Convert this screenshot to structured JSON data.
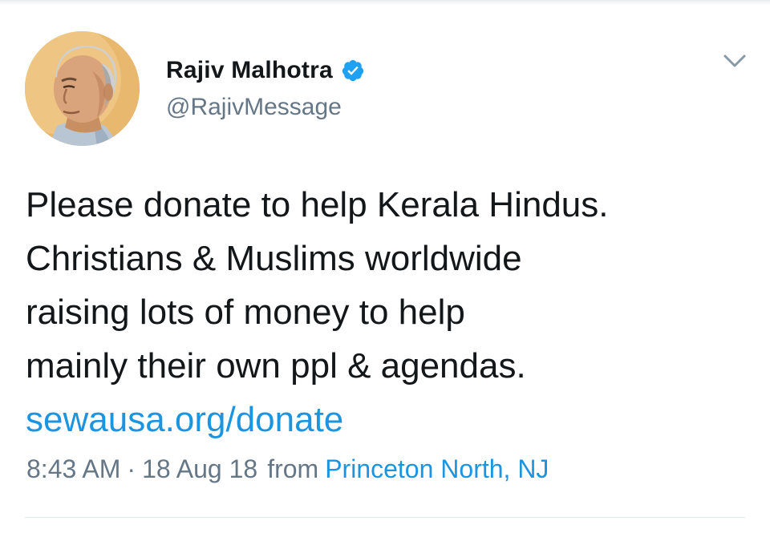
{
  "tweet": {
    "author": {
      "display_name": "Rajiv Malhotra",
      "handle": "@RajivMessage",
      "verified": true,
      "avatar_icon": "profile-photo"
    },
    "text_lines": [
      "Please donate to help Kerala Hindus.",
      "Christians & Muslims worldwide",
      "raising lots of money to help",
      "mainly their own ppl & agendas."
    ],
    "link": "sewausa.org/donate",
    "meta": {
      "time": "8:43 AM",
      "separator": "·",
      "date": "18 Aug 18",
      "from_label": "from",
      "location": "Princeton North, NJ"
    },
    "menu_icon": "chevron-down-icon"
  },
  "colors": {
    "text_primary": "#14171a",
    "text_secondary": "#657786",
    "link": "#1b95e0",
    "verified_badge": "#1da1f2",
    "divider": "#e1e8ed"
  }
}
